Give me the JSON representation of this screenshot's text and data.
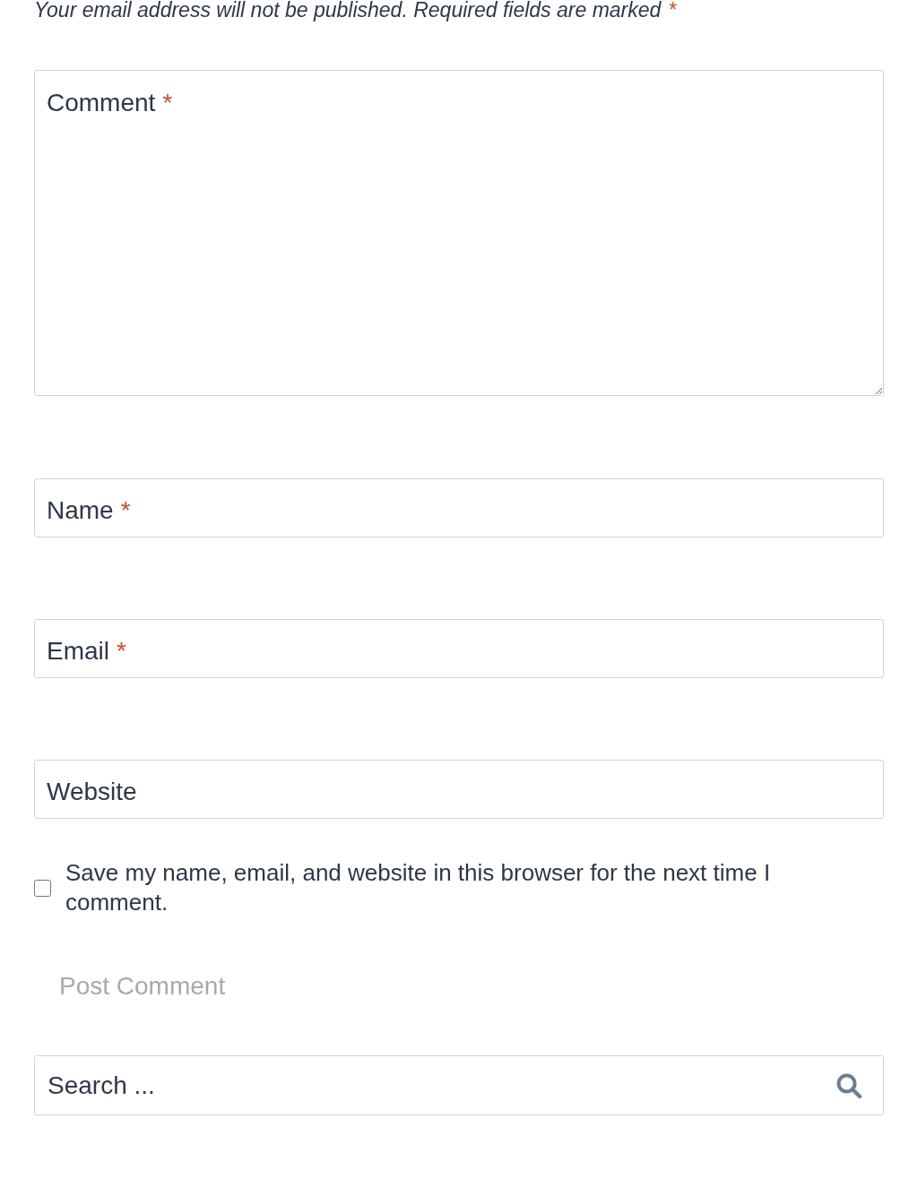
{
  "notice": {
    "text": "Your email address will not be published. Required fields are marked",
    "required_mark": "*"
  },
  "fields": [
    {
      "kind": "textarea",
      "label": "Comment",
      "required_mark": "*"
    },
    {
      "kind": "input",
      "label": "Name",
      "required_mark": "*"
    },
    {
      "kind": "input",
      "label": "Email",
      "required_mark": "*"
    },
    {
      "kind": "input",
      "label": "Website"
    }
  ],
  "save_consent": {
    "label": "Save my name, email, and website in this browser for the next time I comment.",
    "checked": false
  },
  "submit_button": {
    "label": "Post Comment"
  },
  "search": {
    "placeholder": "Search ..."
  }
}
